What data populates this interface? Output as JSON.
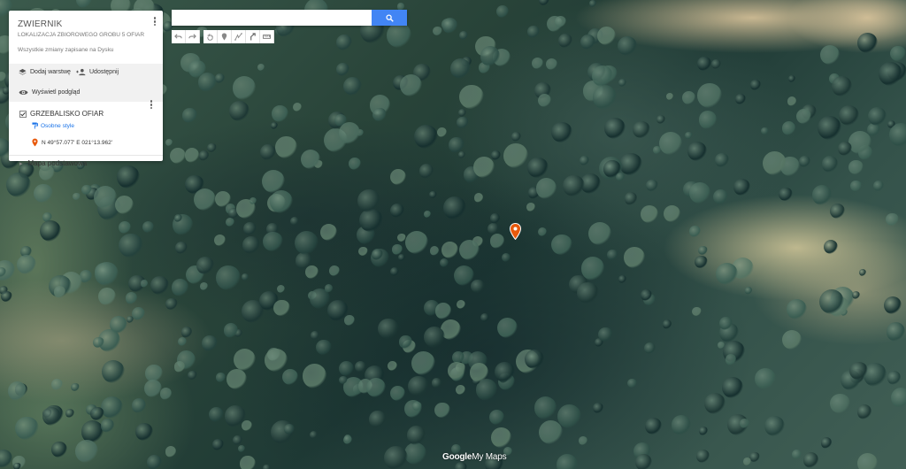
{
  "map": {
    "title": "ZWIERNIK",
    "subtitle": "LOKALIZACJA ZBIOROWEGO GROBU 5 OFIAR",
    "saved_status": "Wszystkie zmiany zapisane na Dysku",
    "menu_icon": "more-vert-icon"
  },
  "actions": {
    "add_layer": "Dodaj warstwę",
    "share": "Udostępnij",
    "preview": "Wyświetl podgląd"
  },
  "layer": {
    "checked": true,
    "title": "GRZEBALISKO OFIAR",
    "style_link": "Osobne style",
    "place": "N 49°57.077' E 021°13.962'"
  },
  "basemap": {
    "label": "Mapa podstawowa"
  },
  "search": {
    "placeholder": "",
    "value": ""
  },
  "toolbar": {
    "tools": [
      "undo-icon",
      "redo-icon",
      "hand-icon",
      "marker-icon",
      "draw-line-icon",
      "directions-icon",
      "ruler-icon"
    ]
  },
  "logo": {
    "google": "Google",
    "mymaps": "My Maps"
  },
  "colors": {
    "accent": "#4285f4",
    "marker": "#e8590c",
    "link": "#1a73e8"
  }
}
